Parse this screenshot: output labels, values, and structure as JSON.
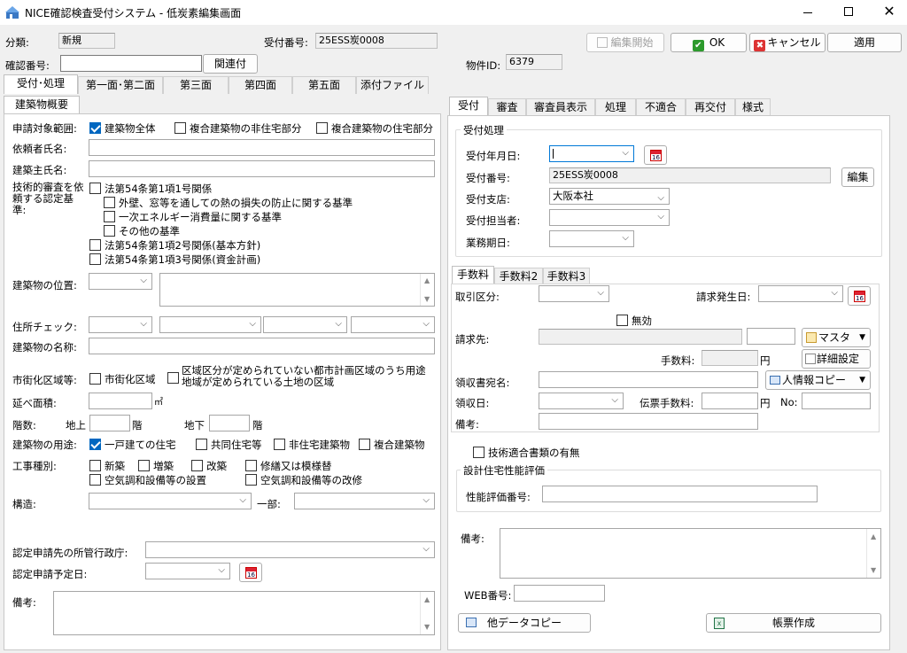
{
  "window": {
    "title": "NICE確認検査受付システム - 低炭素編集画面"
  },
  "top": {
    "bunrui_label": "分類:",
    "bunrui_value": "新規",
    "uketsuke_label": "受付番号:",
    "uketsuke_value": "25ESS炭0008",
    "kakunin_label": "確認番号:",
    "kakunin_value": "",
    "kanren_button": "関連付",
    "bukken_label": "物件ID:",
    "bukken_value": "6379",
    "edit_start_button": "編集開始",
    "ok_button": "OK",
    "cancel_button": "キャンセル",
    "apply_button": "適用"
  },
  "main_tabs": [
    "受付･処理",
    "第一面･第二面",
    "第三面",
    "第四面",
    "第五面",
    "添付ファイル"
  ],
  "left": {
    "tab": "建築物概要",
    "shinsei_label": "申請対象範囲:",
    "shinsei_opts": [
      {
        "label": "建築物全体",
        "checked": true
      },
      {
        "label": "複合建築物の非住宅部分",
        "checked": false
      },
      {
        "label": "複合建築物の住宅部分",
        "checked": false
      }
    ],
    "irai_label": "依頼者氏名:",
    "kenchikunushi_label": "建築主氏名:",
    "gijutsu_label": "技術的審査を依頼する認定基準:",
    "gijutsu_opts": [
      "法第54条第1項1号関係",
      "外壁、窓等を通しての熱の損失の防止に関する基準",
      "一次エネルギー消費量に関する基準",
      "その他の基準",
      "法第54条第1項2号関係(基本方針)",
      "法第54条第1項3号関係(資金計画)"
    ],
    "ichi_label": "建築物の位置:",
    "jusho_label": "住所チェック:",
    "meisho_label": "建築物の名称:",
    "shigaika_label": "市街化区域等:",
    "shigaika_opt1": "市街化区域",
    "shigaika_opt2_l1": "区域区分が定められていない都市計画区域のうち用途",
    "shigaika_opt2_l2": "地域が定められている土地の区域",
    "menseki_label": "延べ面積:",
    "menseki_unit": "㎡",
    "kaisu_label": "階数:",
    "chijo_label": "地上",
    "chika_label": "地下",
    "kai_unit": "階",
    "yoto_label": "建築物の用途:",
    "yoto_opts": [
      {
        "label": "一戸建ての住宅",
        "checked": true
      },
      {
        "label": "共同住宅等",
        "checked": false
      },
      {
        "label": "非住宅建築物",
        "checked": false
      },
      {
        "label": "複合建築物",
        "checked": false
      }
    ],
    "koji_label": "工事種別:",
    "koji_opts": [
      "新築",
      "増築",
      "改築",
      "修繕又は模様替",
      "空気調和設備等の設置",
      "空気調和設備等の改修"
    ],
    "kozo_label": "構造:",
    "ichibu_label": "一部:",
    "shokan_label": "認定申請先の所管行政庁:",
    "yotei_label": "認定申請予定日:",
    "biko_label": "備考:",
    "cal_text": "16"
  },
  "right": {
    "tabs": [
      "受付",
      "審査",
      "審査員表示",
      "処理",
      "不適合",
      "再交付",
      "様式"
    ],
    "group1": "受付処理",
    "nengappi_label": "受付年月日:",
    "bango_label": "受付番号:",
    "bango_value": "25ESS炭0008",
    "edit_button": "編集",
    "shiten_label": "受付支店:",
    "shiten_value": "大阪本社",
    "tanto_label": "受付担当者:",
    "kijitsu_label": "業務期日:",
    "fee_tabs": [
      "手数料",
      "手数料2",
      "手数料3"
    ],
    "torihiki_label": "取引区分:",
    "hassei_label": "請求発生日:",
    "muko_label": "無効",
    "seikyu_label": "請求先:",
    "master_button": "マスタ",
    "tesuryo_label": "手数料:",
    "yen": "円",
    "shosai_button": "詳細設定",
    "atena_label": "領収書宛名:",
    "copy_button": "人情報コピー",
    "ryoshubi_label": "領収日:",
    "denpyo_label": "伝票手数料:",
    "no_label": "No:",
    "fee_biko_label": "備考:",
    "tekigo_label": "技術適合書類の有無",
    "group2": "設計住宅性能評価",
    "seino_label": "性能評価番号:",
    "biko_label": "備考:",
    "web_label": "WEB番号:",
    "other_copy_button": "他データコピー",
    "report_button": "帳票作成"
  }
}
